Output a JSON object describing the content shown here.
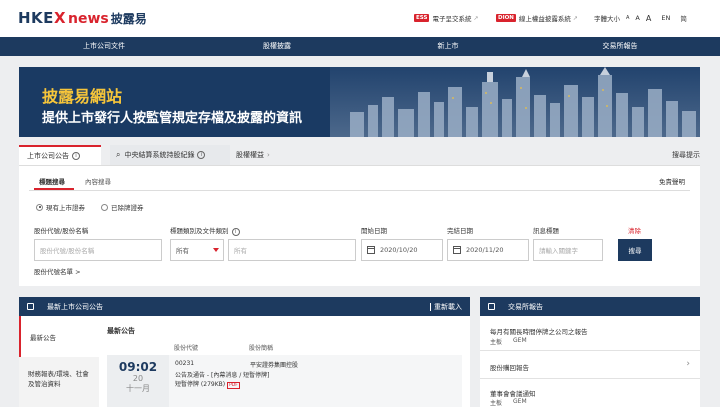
{
  "logo": {
    "part1": "HKE",
    "part2": "X",
    "part3": "news",
    "part4": "披露易"
  },
  "toplinks": {
    "ess_tag": "ESS",
    "ess_label": "電子呈交系統",
    "dion_tag": "DION",
    "dion_label": "線上權益披露系統",
    "fontsize_label": "字體大小",
    "font_a1": "A",
    "font_a2": "A",
    "font_a3": "A",
    "lang_en": "EN",
    "lang_cn": "简"
  },
  "nav": [
    "上市公司文件",
    "股權披露",
    "新上市",
    "交易所報告"
  ],
  "banner": {
    "title": "披露易網站",
    "subtitle": "提供上市發行人按監管規定存檔及披露的資訊"
  },
  "search": {
    "tab1": "上市公司公告",
    "tab2": "中央結算系統持股紀錄",
    "tab3": "股權權益",
    "tips": "搜尋提示",
    "sub1": "標題搜尋",
    "sub2": "內容搜尋",
    "disclaimer": "免責聲明",
    "radio1": "現有上市證券",
    "radio2": "已除牌證券",
    "stock_label": "股份代號/股份名稱",
    "stock_ph": "股份代號/股份名稱",
    "cat_label": "標題類別及文件類別",
    "cat_value": "所有",
    "cat2_value": "所有",
    "start_label": "開始日期",
    "start_value": "2020/10/20",
    "end_label": "完結日期",
    "end_value": "2020/11/20",
    "keyword_label": "訊息標題",
    "keyword_ph": "請輸入關鍵字",
    "clear": "清除",
    "search_btn": "搜尋",
    "code_list": "股份代號名單 >"
  },
  "announcements": {
    "header": "最新上市公司公告",
    "reload": "重新載入",
    "side1": "最新公告",
    "side2": "財務報表/環境、社會及管治資料",
    "latest": "最新公告",
    "col_code": "股份代號",
    "col_name": "股份簡稱",
    "row": {
      "time": "09:02",
      "day": "20",
      "month": "十一月",
      "code": "00231",
      "name": "平安證券集團控股",
      "line1": "公告及通告 - [內幕消息 / 短暫停牌]",
      "line2": "短暫停牌 (279KB)",
      "pdf": "PDF"
    }
  },
  "reports": {
    "header": "交易所報告",
    "item1": "每月有關長時間停牌之公司之報告",
    "item1_sub1": "主板",
    "item1_sub2": "GEM",
    "item2": "股份購回報告",
    "item3": "董事會會議通知",
    "item3_sub1": "主板",
    "item3_sub2": "GEM"
  },
  "colors": {
    "navy": "#1d3a5f",
    "red": "#d9232d",
    "gold": "#f6c53a"
  }
}
